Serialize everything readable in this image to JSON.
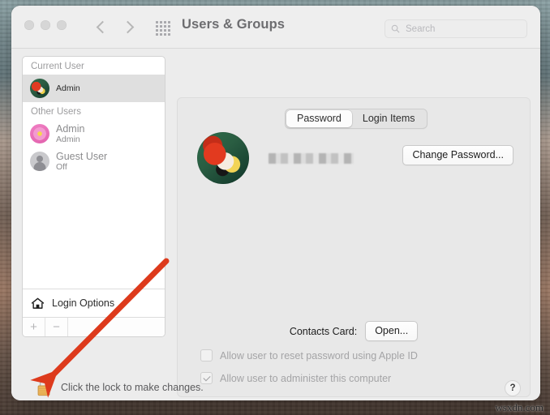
{
  "window": {
    "title": "Users & Groups",
    "traffic_lights": [
      "close",
      "minimize",
      "zoom"
    ],
    "nav": {
      "back": "back-chevron",
      "forward": "forward-chevron"
    },
    "grid_icon": "show-all-preferences-grid-icon"
  },
  "search": {
    "placeholder": "Search",
    "value": "",
    "icon": "search-icon"
  },
  "sidebar": {
    "groups": [
      {
        "label": "Current User",
        "users": [
          {
            "name": "",
            "name_redacted": true,
            "role": "Admin",
            "avatar": "parrot-photo-avatar",
            "selected": true
          }
        ]
      },
      {
        "label": "Other Users",
        "users": [
          {
            "name": "Admin",
            "name_redacted": false,
            "role": "Admin",
            "avatar": "pink-flower-avatar",
            "selected": false
          },
          {
            "name": "Guest User",
            "name_redacted": false,
            "role": "Off",
            "avatar": "guest-person-silhouette-avatar",
            "selected": false
          }
        ]
      }
    ],
    "login_options": {
      "label": "Login Options",
      "icon": "home-icon"
    },
    "toolbar": {
      "add_label": "+",
      "remove_label": "−"
    }
  },
  "main": {
    "tabs": [
      {
        "label": "Password",
        "active": true
      },
      {
        "label": "Login Items",
        "active": false
      }
    ],
    "user": {
      "avatar": "parrot-photo-avatar",
      "display_name": "",
      "display_name_redacted": true
    },
    "change_password_label": "Change Password...",
    "contacts": {
      "label": "Contacts Card:",
      "open_label": "Open..."
    },
    "checkboxes": [
      {
        "label": "Allow user to reset password using Apple ID",
        "checked": false,
        "disabled": true
      },
      {
        "label": "Allow user to administer this computer",
        "checked": true,
        "disabled": true
      }
    ]
  },
  "footer": {
    "lock_icon": "closed-padlock-icon",
    "lock_text": "Click the lock to make changes.",
    "help_label": "?"
  },
  "annotation": {
    "type": "red-arrow",
    "color": "#e03a1e",
    "points_to": "lock-icon"
  },
  "watermark": "wsxdn.com"
}
